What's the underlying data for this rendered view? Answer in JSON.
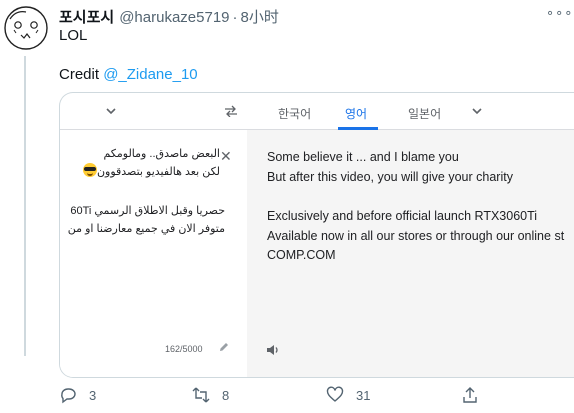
{
  "tweet": {
    "display_name": "포시포시",
    "handle": "@harukaze5719",
    "separator": "·",
    "time": "8小时",
    "more": "∘∘∘",
    "text_line1": "LOL",
    "credit_prefix": "Credit ",
    "credit_mention": "@_Zidane_10"
  },
  "translate_card": {
    "swap_icon": "swap-arrows-icon",
    "languages": [
      "한국어",
      "영어",
      "일본어"
    ],
    "active_language": "영어",
    "source_lines": [
      "البعض ماصدق.. ومالومكم",
      "لكن بعد هالفيديو بتصدقوون",
      "حصريا وقبل الاطلاق الرسمي 60Ti",
      "متوفر الان في جميع معارضنا او من"
    ],
    "emoji": "sunglasses-emoji",
    "char_count": "162/5000",
    "target_lines": [
      "Some believe it ... and I blame you",
      "But after this video, you will give your charity",
      "Exclusively and before official launch RTX3060Ti",
      "Available now in all our stores or through our online st",
      "COMP.COM"
    ]
  },
  "actions": {
    "reply_count": "3",
    "retweet_count": "8",
    "like_count": "31"
  },
  "colors": {
    "link": "#1d9bf0",
    "active_tab": "#1a73e8",
    "muted": "#536471"
  }
}
